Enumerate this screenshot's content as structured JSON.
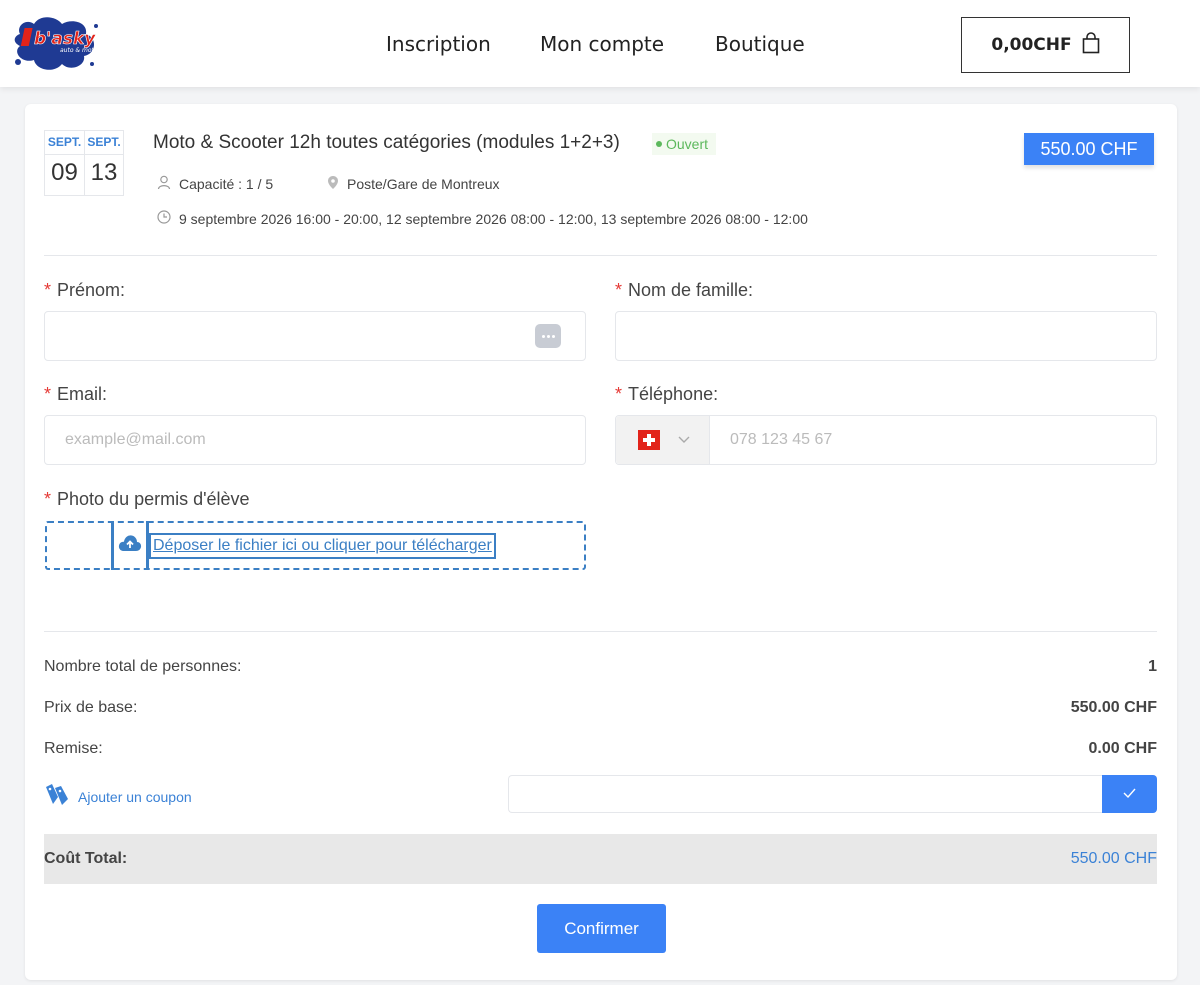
{
  "header": {
    "logo_text": "b'asky",
    "logo_subtext": "auto & moto",
    "nav": [
      "Inscription",
      "Mon compte",
      "Boutique"
    ],
    "cart_total": "0,00CHF"
  },
  "event": {
    "dates": [
      {
        "month": "SEPT.",
        "day": "09"
      },
      {
        "month": "SEPT.",
        "day": "13"
      }
    ],
    "title": "Moto & Scooter 12h toutes catégories (modules 1+2+3)",
    "status": "Ouvert",
    "price": "550.00 CHF",
    "capacity": "Capacité : 1 / 5",
    "location": "Poste/Gare de Montreux",
    "schedule": "9 septembre 2026 16:00 - 20:00, 12 septembre 2026 08:00 - 12:00, 13 septembre 2026 08:00 - 12:00"
  },
  "form": {
    "required_mark": "*",
    "first_name_label": "Prénom:",
    "last_name_label": "Nom de famille:",
    "email_label": "Email:",
    "email_placeholder": "example@mail.com",
    "phone_label": "Téléphone:",
    "phone_placeholder": "078 123 45 67",
    "phone_country": "CH",
    "permit_label": "Photo du permis d'élève",
    "upload_text": "Déposer le fichier ici ou cliquer pour télécharger"
  },
  "summary": {
    "people_label": "Nombre total de personnes:",
    "people_value": "1",
    "base_label": "Prix de base:",
    "base_value": "550.00 CHF",
    "discount_label": "Remise:",
    "discount_value": "0.00 CHF",
    "coupon_label": "Ajouter un coupon",
    "total_label": "Coût Total:",
    "total_value": "550.00 CHF"
  },
  "confirm_label": "Confirmer",
  "colors": {
    "accent": "#3b82f6",
    "status_green": "#5cb85c",
    "required_red": "#e53935"
  }
}
